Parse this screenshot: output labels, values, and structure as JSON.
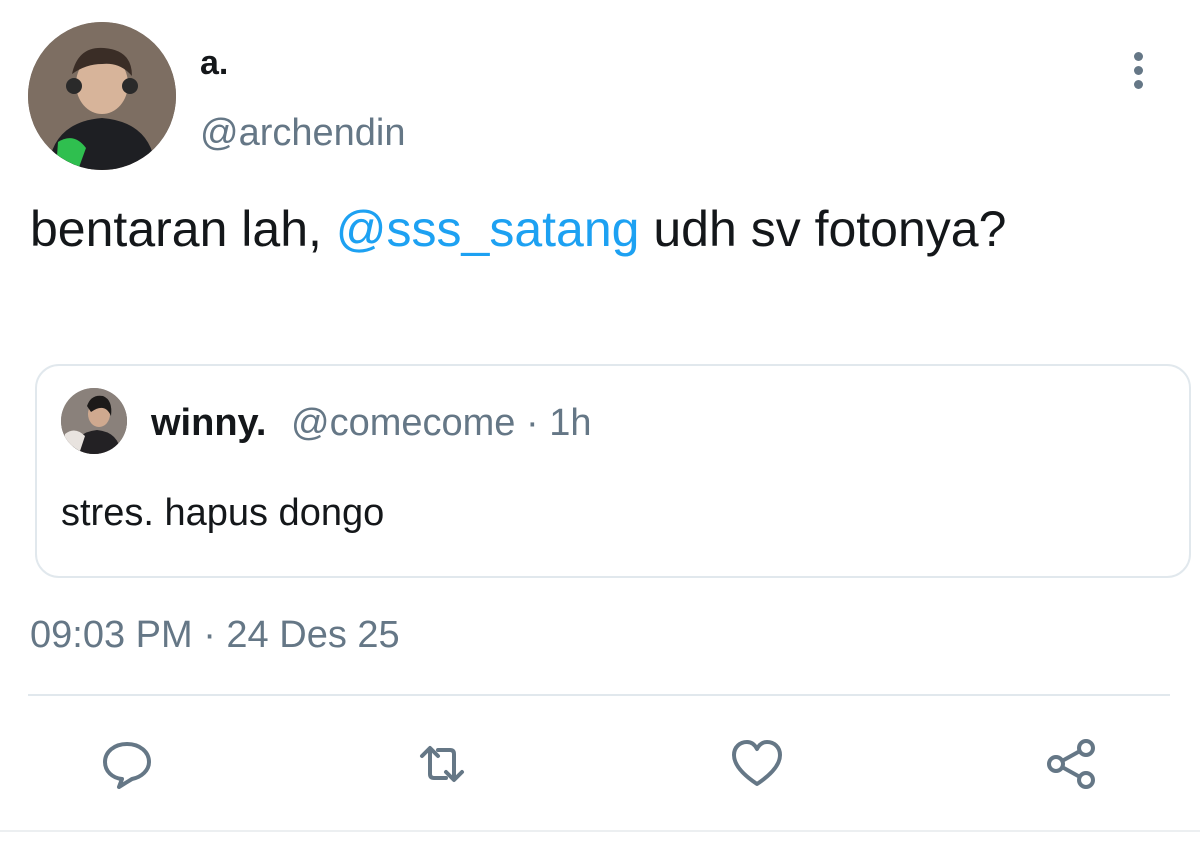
{
  "tweet": {
    "author": {
      "display_name": "a.",
      "handle": "@archendin",
      "avatar_icon": "profile-photo-icon"
    },
    "text_before": "bentaran lah, ",
    "mention": "@sss_satang",
    "text_after": " udh sv fotonya?",
    "quoted": {
      "display_name": "winny.",
      "meta": "@comecome · 1h",
      "text": "stres. hapus dongo"
    },
    "timestamp": "09:03 PM · 24 Des 25"
  },
  "actions": {
    "reply_icon": "reply-bubble-icon",
    "retweet_icon": "retweet-icon",
    "like_icon": "heart-icon",
    "share_icon": "share-icon",
    "more_icon": "more-vertical-icon"
  },
  "colors": {
    "text": "#14171a",
    "secondary": "#657786",
    "mention": "#1da1f2",
    "border": "#e1e8ed"
  }
}
